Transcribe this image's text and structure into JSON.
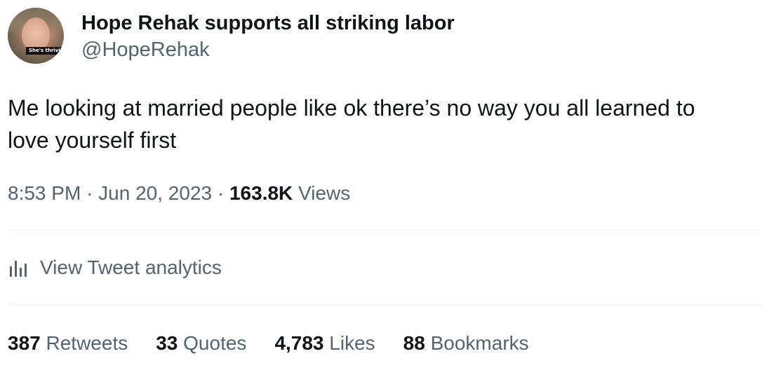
{
  "author": {
    "display_name": "Hope Rehak supports all striking labor",
    "handle": "@HopeRehak",
    "avatar_caption": "She's thriving"
  },
  "tweet": {
    "text_line1": "Me looking at married people like ok there’s no way you all learned to",
    "text_line2": "love yourself first"
  },
  "meta": {
    "time": "8:53 PM",
    "separator": "·",
    "date": "Jun 20, 2023",
    "views_count": "163.8K",
    "views_label": "Views"
  },
  "analytics": {
    "label": "View Tweet analytics",
    "icon": "analytics-bar-icon"
  },
  "stats": [
    {
      "count": "387",
      "label": "Retweets"
    },
    {
      "count": "33",
      "label": "Quotes"
    },
    {
      "count": "4,783",
      "label": "Likes"
    },
    {
      "count": "88",
      "label": "Bookmarks"
    }
  ],
  "colors": {
    "primary_text": "#0f1419",
    "secondary_text": "#536471",
    "divider": "#eff3f4",
    "background": "#ffffff"
  }
}
